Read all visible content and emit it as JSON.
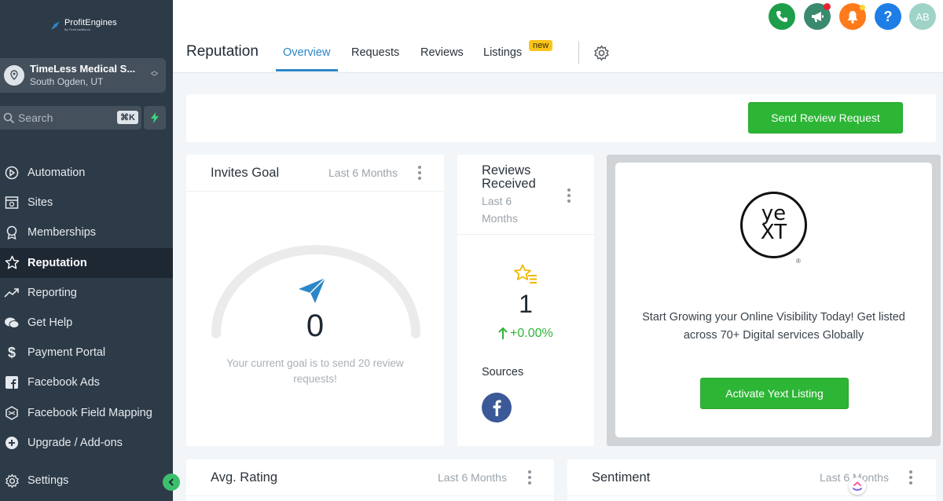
{
  "brand": {
    "name": "ProfitEngines",
    "tagline": "By FirstLeadBoom"
  },
  "account": {
    "name": "TimeLess Medical S...",
    "location": "South Ogden, UT"
  },
  "search": {
    "placeholder": "Search",
    "shortcut": "⌘K"
  },
  "nav": {
    "items": [
      {
        "label": "Automation",
        "icon": "play-circle-icon"
      },
      {
        "label": "Sites",
        "icon": "sites-icon"
      },
      {
        "label": "Memberships",
        "icon": "award-icon"
      },
      {
        "label": "Reputation",
        "icon": "star-icon",
        "active": true
      },
      {
        "label": "Reporting",
        "icon": "trend-icon"
      },
      {
        "label": "Get Help",
        "icon": "chat-icon"
      },
      {
        "label": "Payment Portal",
        "icon": "dollar-icon"
      },
      {
        "label": "Facebook Ads",
        "icon": "facebook-square-icon"
      },
      {
        "label": "Facebook Field Mapping",
        "icon": "mapping-icon"
      },
      {
        "label": "Upgrade / Add-ons",
        "icon": "plus-circle-icon"
      }
    ],
    "settings": "Settings"
  },
  "topbar": {
    "avatar_initials": "AB",
    "icons": [
      "phone-icon",
      "megaphone-icon",
      "bell-icon",
      "help-icon"
    ],
    "colors": {
      "phone": "#1e9e4a",
      "megaphone": "#3a8a6e",
      "bell": "#ff7a1a",
      "help": "#1e7ee6",
      "avatar": "#9fd3c7"
    }
  },
  "header": {
    "title": "Reputation",
    "tabs": [
      "Overview",
      "Requests",
      "Reviews",
      "Listings"
    ],
    "active_tab": "Overview",
    "new_badge": "new"
  },
  "actions": {
    "send_review_request": "Send Review Request"
  },
  "invites_goal": {
    "title": "Invites Goal",
    "period": "Last 6 Months",
    "value": "0",
    "message_line1": "Your current goal is to send 20 review",
    "message_line2": "requests!"
  },
  "reviews_received": {
    "title_line1": "Reviews",
    "title_line2": "Received",
    "period_line1": "Last 6",
    "period_line2": "Months",
    "value": "1",
    "change": "+0.00%",
    "sources_label": "Sources"
  },
  "yext": {
    "logo_line1": "ye",
    "logo_line2": "xt",
    "registered": "®",
    "text_line1": "Start Growing your Online Visibility Today! Get listed",
    "text_line2": "across 70+ Digital services Globally",
    "button": "Activate Yext Listing"
  },
  "avg_rating": {
    "title": "Avg. Rating",
    "period": "Last 6 Months"
  },
  "sentiment": {
    "title": "Sentiment",
    "period": "Last 6 Months"
  },
  "colors": {
    "accent_blue": "#2b87c7",
    "green": "#2db536",
    "sidebar": "#2d3a47",
    "facebook": "#3b5998"
  }
}
